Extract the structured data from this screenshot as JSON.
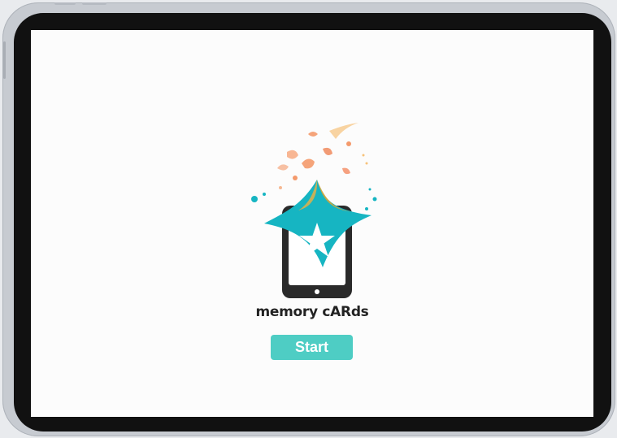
{
  "app": {
    "title": "memory cARds",
    "start_label": "Start"
  },
  "logo": {
    "icon": "phone-star-splash-icon"
  },
  "colors": {
    "accent": "#4ecdc4",
    "star_teal": "#16b5c2",
    "splash_orange": "#f49a6c",
    "splash_gold": "#d4a53a",
    "phone_dark": "#2a2a2a",
    "screen_bg": "#fcfcfc",
    "bezel": "#111111",
    "frame": "#c7cbd1"
  }
}
